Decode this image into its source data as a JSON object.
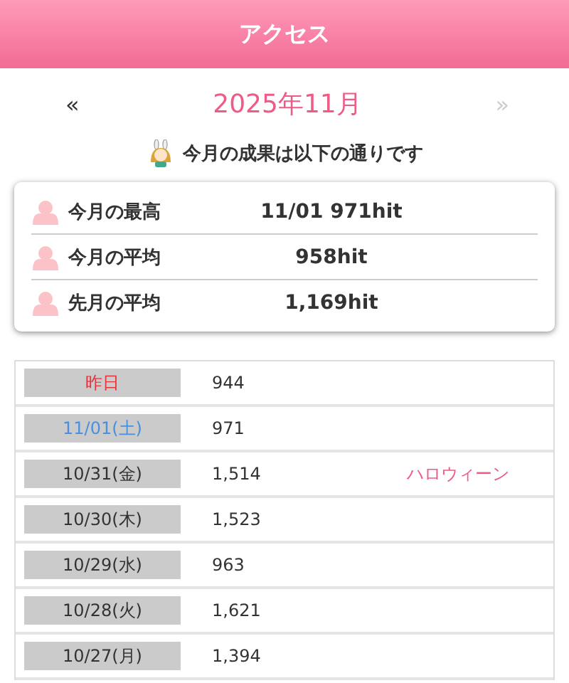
{
  "header": {
    "title": "アクセス"
  },
  "month_nav": {
    "prev": "«",
    "month": "2025年11月",
    "next": "»",
    "next_disabled": true
  },
  "subtitle": "今月の成果は以下の通りです",
  "summary": [
    {
      "label": "今月の最高",
      "value": "11/01 971hit"
    },
    {
      "label": "今月の平均",
      "value": "958hit"
    },
    {
      "label": "先月の平均",
      "value": "1,169hit"
    }
  ],
  "days": [
    {
      "kind": "yesterday",
      "date": "昨日",
      "hits": "944"
    },
    {
      "kind": "saturday",
      "date": "11/01(土)",
      "hits": "971"
    },
    {
      "kind": "weekday",
      "date": "10/31(金)",
      "hits": "1,514",
      "note": "ハロウィーン"
    },
    {
      "kind": "weekday",
      "date": "10/30(木)",
      "hits": "1,523"
    },
    {
      "kind": "weekday",
      "date": "10/29(水)",
      "hits": "963"
    },
    {
      "kind": "weekday",
      "date": "10/28(火)",
      "hits": "1,621"
    },
    {
      "kind": "weekday",
      "date": "10/27(月)",
      "hits": "1,394"
    }
  ]
}
